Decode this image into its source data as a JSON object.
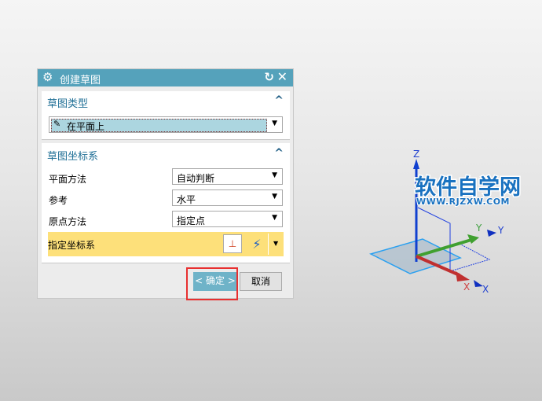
{
  "dialog": {
    "title": "创建草图",
    "type_section": {
      "title": "草图类型",
      "selected": "在平面上"
    },
    "csys_section": {
      "title": "草图坐标系",
      "rows": [
        {
          "label": "平面方法",
          "value": "自动判断"
        },
        {
          "label": "参考",
          "value": "水平"
        },
        {
          "label": "原点方法",
          "value": "指定点"
        }
      ],
      "specify_label": "指定坐标系"
    },
    "ok_label": "< 确定 >",
    "cancel_label": "取消"
  },
  "viewport": {
    "axes": {
      "z": "Z",
      "y": "Y",
      "x": "X"
    },
    "watermark": "软件自学网",
    "watermark_url": "WWW.RJZXW.COM"
  },
  "colors": {
    "title_bar": "#55a2bb",
    "highlight": "#fde07a",
    "ok": "#6fb3c8"
  }
}
